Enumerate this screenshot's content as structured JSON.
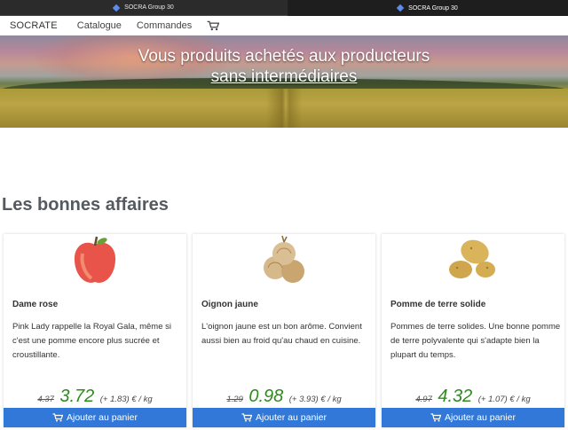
{
  "titlebar": {
    "left_title": "SOCRA Group 30",
    "right_title": "SOCRA Group 30"
  },
  "nav": {
    "brand": "SOCRATE",
    "links": [
      "Catalogue",
      "Commandes"
    ],
    "cart_icon": "cart-icon"
  },
  "hero": {
    "line1": "Vous produits achetés aux producteurs",
    "line2": "sans intermédiaires"
  },
  "section": {
    "title": "Les bonnes affaires"
  },
  "products": [
    {
      "name": "Dame rose",
      "description": "Pink Lady rappelle la Royal Gala, même si c'est une pomme encore plus sucrée et croustillante.",
      "old_price": "4.37",
      "price": "3.72",
      "extra": "(+ 1.83) € / kg",
      "button": "Ajouter au panier",
      "image": "apple"
    },
    {
      "name": "Oignon jaune",
      "description": "L'oignon jaune est un bon arôme. Convient aussi bien au froid qu'au chaud en cuisine.",
      "old_price": "1.29",
      "price": "0.98",
      "extra": "(+ 3.93) € / kg",
      "button": "Ajouter au panier",
      "image": "onion"
    },
    {
      "name": "Pomme de terre solide",
      "description": "Pommes de terre solides. Une bonne pomme de terre polyvalente qui s'adapte bien la plupart du temps.",
      "old_price": "4.97",
      "price": "4.32",
      "extra": "(+ 1.07) € / kg",
      "button": "Ajouter au panier",
      "image": "potato"
    }
  ],
  "colors": {
    "button": "#3178d8",
    "price": "#2e8b1e"
  }
}
